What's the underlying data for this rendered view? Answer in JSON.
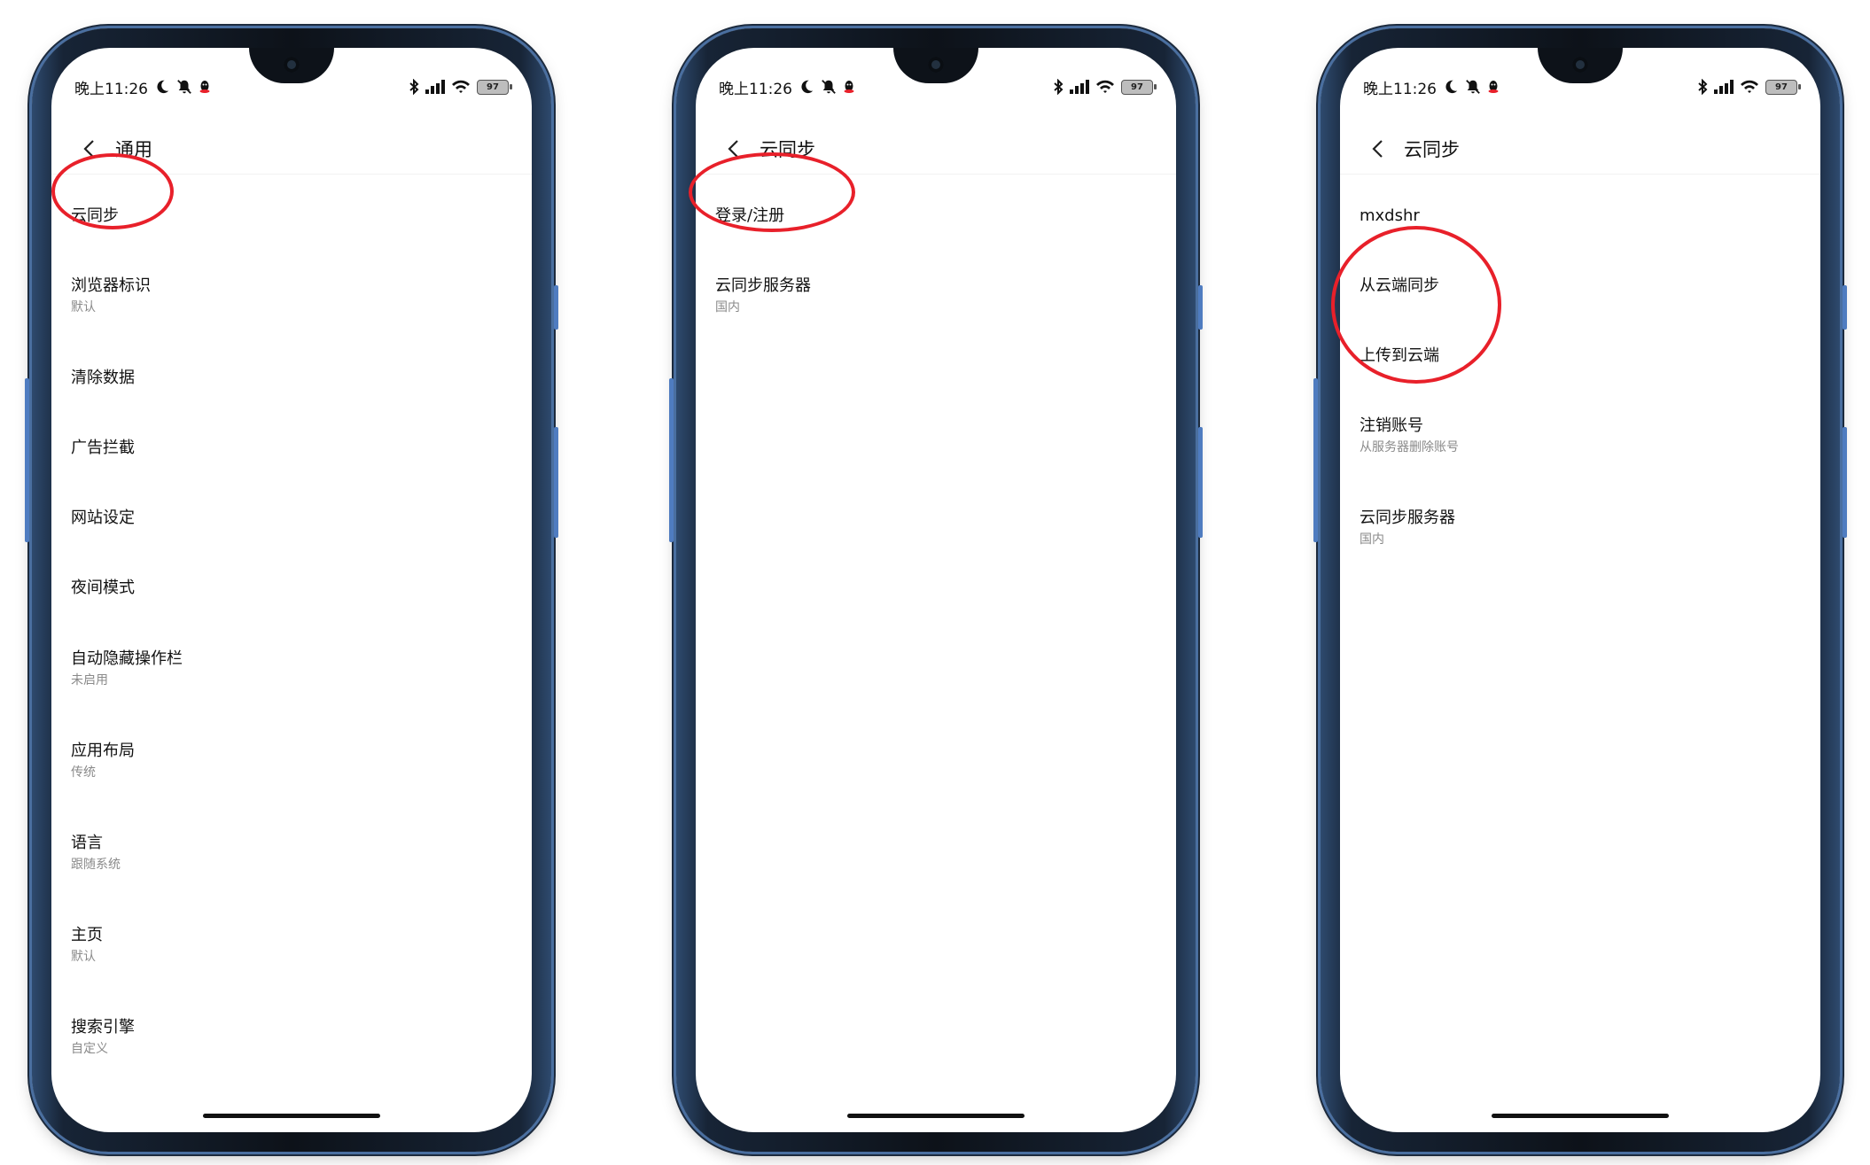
{
  "status": {
    "time": "晚上11:26",
    "battery": "97",
    "icons": [
      "moon-icon",
      "bell-off-icon",
      "qq-icon",
      "bluetooth-icon",
      "signal-icon",
      "wifi-icon",
      "battery-icon"
    ]
  },
  "screens": [
    {
      "title": "通用",
      "items": [
        {
          "title": "云同步"
        },
        {
          "title": "浏览器标识",
          "sub": "默认"
        },
        {
          "title": "清除数据"
        },
        {
          "title": "广告拦截"
        },
        {
          "title": "网站设定"
        },
        {
          "title": "夜间模式"
        },
        {
          "title": "自动隐藏操作栏",
          "sub": "未启用"
        },
        {
          "title": "应用布局",
          "sub": "传统"
        },
        {
          "title": "语言",
          "sub": "跟随系统"
        },
        {
          "title": "主页",
          "sub": "默认"
        },
        {
          "title": "搜索引擎",
          "sub": "自定义"
        }
      ]
    },
    {
      "title": "云同步",
      "items": [
        {
          "title": "登录/注册"
        },
        {
          "title": "云同步服务器",
          "sub": "国内"
        }
      ]
    },
    {
      "title": "云同步",
      "items": [
        {
          "title": "mxdshr"
        },
        {
          "title": "从云端同步"
        },
        {
          "title": "上传到云端"
        },
        {
          "title": "注销账号",
          "sub": "从服务器删除账号"
        },
        {
          "title": "云同步服务器",
          "sub": "国内"
        }
      ]
    }
  ],
  "colors": {
    "highlight_circle": "#e8202a",
    "frame": "#0d1219",
    "frame_edge": "#4a6fa0"
  }
}
